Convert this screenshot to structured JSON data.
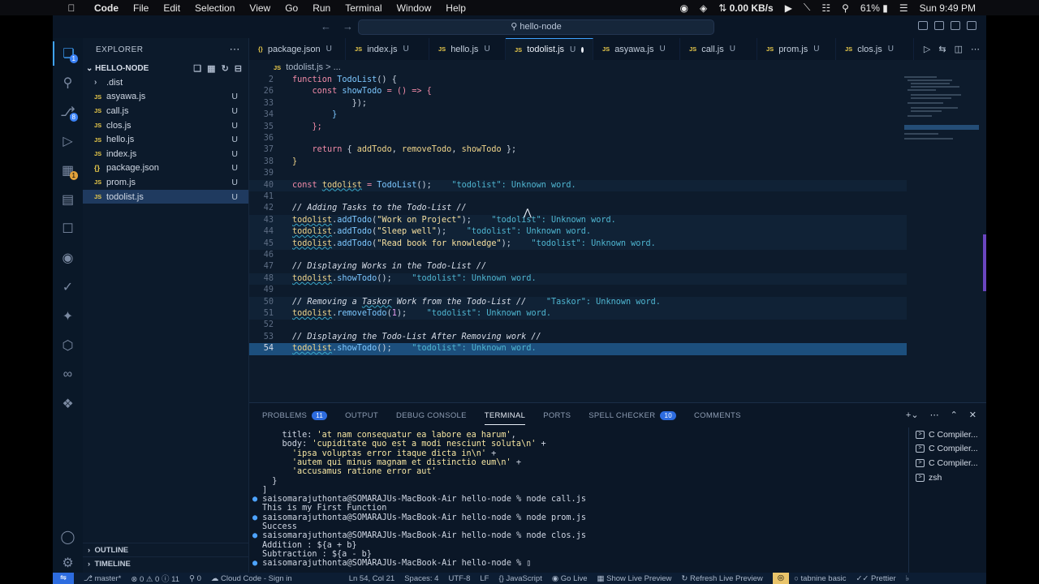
{
  "menubar": {
    "app": "Code",
    "items": [
      "File",
      "Edit",
      "Selection",
      "View",
      "Go",
      "Run",
      "Terminal",
      "Window",
      "Help"
    ],
    "network": "0.00 KB/s",
    "battery": "61%",
    "clock": "Sun 9:49 PM"
  },
  "titlebar": {
    "search": "hello-node"
  },
  "activity": {
    "explorer_badge": "1",
    "scm_badge": "8",
    "warn_badge": "1"
  },
  "sidebar": {
    "title": "EXPLORER",
    "folder": "HELLO-NODE",
    "items": [
      {
        "icon": "",
        "name": ".dist",
        "status": ""
      },
      {
        "icon": "JS",
        "name": "asyawa.js",
        "status": "U"
      },
      {
        "icon": "JS",
        "name": "call.js",
        "status": "U"
      },
      {
        "icon": "JS",
        "name": "clos.js",
        "status": "U"
      },
      {
        "icon": "JS",
        "name": "hello.js",
        "status": "U"
      },
      {
        "icon": "JS",
        "name": "index.js",
        "status": "U"
      },
      {
        "icon": "{}",
        "name": "package.json",
        "status": "U"
      },
      {
        "icon": "JS",
        "name": "prom.js",
        "status": "U"
      },
      {
        "icon": "JS",
        "name": "todolist.js",
        "status": "U"
      }
    ],
    "outline": "OUTLINE",
    "timeline": "TIMELINE"
  },
  "tabs": [
    {
      "icon": "{}",
      "name": "package.json",
      "status": "U"
    },
    {
      "icon": "JS",
      "name": "index.js",
      "status": "U"
    },
    {
      "icon": "JS",
      "name": "hello.js",
      "status": "U"
    },
    {
      "icon": "JS",
      "name": "todolist.js",
      "status": "U"
    },
    {
      "icon": "JS",
      "name": "asyawa.js",
      "status": "U"
    },
    {
      "icon": "JS",
      "name": "call.js",
      "status": "U"
    },
    {
      "icon": "JS",
      "name": "prom.js",
      "status": "U"
    },
    {
      "icon": "JS",
      "name": "clos.js",
      "status": "U"
    }
  ],
  "breadcrumb": {
    "icon": "JS",
    "file": "todolist.js",
    "sep": ">",
    "rest": "..."
  },
  "code": {
    "l1": "2",
    "l2": "26",
    "l3": "33",
    "l4": "34",
    "l5": "35",
    "l6": "36",
    "l7": "37",
    "l8": "38",
    "l9": "39",
    "l10": "40",
    "l11": "41",
    "l12": "42",
    "l13": "43",
    "l14": "44",
    "l15": "45",
    "l16": "46",
    "l17": "47",
    "l18": "48",
    "l19": "49",
    "l20": "50",
    "l21": "51",
    "l22": "52",
    "l23": "53",
    "l24": "54",
    "fn_kw": "function",
    "fn_name": "TodoList",
    "fn_rest": "() {",
    "const": "const",
    "showTodo": "showTodo",
    "arrow": " = () => {",
    "close33": "});",
    "close34": "}",
    "close35": "};",
    "return": "return",
    "ret_open": " { ",
    "addTodo": "addTodo",
    "comma": ", ",
    "removeTodo": "removeTodo",
    "ret_close": " };",
    "brace": "}",
    "todolist": "todolist",
    "assign": " = ",
    "ctor_call": "();",
    "diag_todolist": "\"todolist\": Unknown word.",
    "diag_taskor": "\"Taskor\": Unknown word.",
    "c42": "// Adding Tasks to the Todo-List //",
    "dot": ".",
    "open": "(",
    "s43": "\"Work on Project\"",
    "s44": "\"Sleep well\"",
    "s45": "\"Read book for knowledge\"",
    "endcall": ");",
    "c47": "// Displaying Works in the Todo-List //",
    "emptycall": "();",
    "c50a": "// Removing a ",
    "c50b": "Taskor",
    "c50c": " Work from the Todo-List //",
    "one": "1",
    "c53": "// Displaying the Todo-List After Removing work //"
  },
  "panel": {
    "tabs": [
      "PROBLEMS",
      "OUTPUT",
      "DEBUG CONSOLE",
      "TERMINAL",
      "PORTS",
      "SPELL CHECKER",
      "COMMENTS"
    ],
    "problems_badge": "11",
    "spell_badge": "10",
    "terminal": {
      "t1a": "    title: ",
      "t1b": "'at nam consequatur ea labore ea harum'",
      "t1c": ",",
      "t2a": "    body: ",
      "t2b": "'cupiditate quo est a modi nesciunt soluta\\n'",
      "t2c": " +",
      "t3b": "'ipsa voluptas error itaque dicta in\\n'",
      "t4b": "'autem qui minus magnam et distinctio eum\\n'",
      "t5b": "'accusamus ratione error aut'",
      "t6": "  }",
      "t7": "]",
      "prompt": "saisomarajuthonta@SOMARAJUs-MacBook-Air hello-node %",
      "cmd1": "node call.js",
      "out1": "This is my First Function",
      "cmd2": "node prom.js",
      "out2": "Success",
      "cmd3": "node clos.js",
      "out3": "Addition : ${a + b}",
      "out4": "Subtraction : ${a - b}"
    },
    "terminals": [
      "C Compiler...",
      "C Compiler...",
      "C Compiler...",
      "zsh"
    ]
  },
  "status": {
    "branch": "master*",
    "errors": "0",
    "warnings": "0",
    "info": "11",
    "ports": "0",
    "cloud": "Cloud Code - Sign in",
    "position": "Ln 54, Col 21",
    "spaces": "Spaces: 4",
    "encoding": "UTF-8",
    "eol": "LF",
    "language": "JavaScript",
    "golive": "Go Live",
    "preview": "Show Live Preview",
    "refresh": "Refresh Live Preview",
    "tabnine": "tabnine basic",
    "prettier": "Prettier"
  }
}
